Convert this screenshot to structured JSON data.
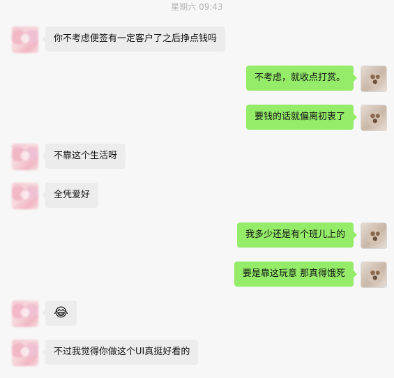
{
  "chat": {
    "timestamp": "星期六 09:43",
    "messages": [
      {
        "side": "left",
        "text": "你不考虑便签有一定客户了之后挣点钱吗"
      },
      {
        "side": "right",
        "text": "不考虑，就收点打赏。"
      },
      {
        "side": "right",
        "text": "要钱的话就偏离初衷了"
      },
      {
        "side": "left",
        "text": "不靠这个生活呀"
      },
      {
        "side": "left",
        "text": "全凭爱好"
      },
      {
        "side": "right",
        "text": "我多少还是有个班儿上的"
      },
      {
        "side": "right",
        "text": "要是靠这玩意 那真得饿死"
      },
      {
        "side": "left",
        "text": "😂"
      },
      {
        "side": "left",
        "text": "不过我觉得你做这个UI真挺好看的"
      }
    ]
  }
}
